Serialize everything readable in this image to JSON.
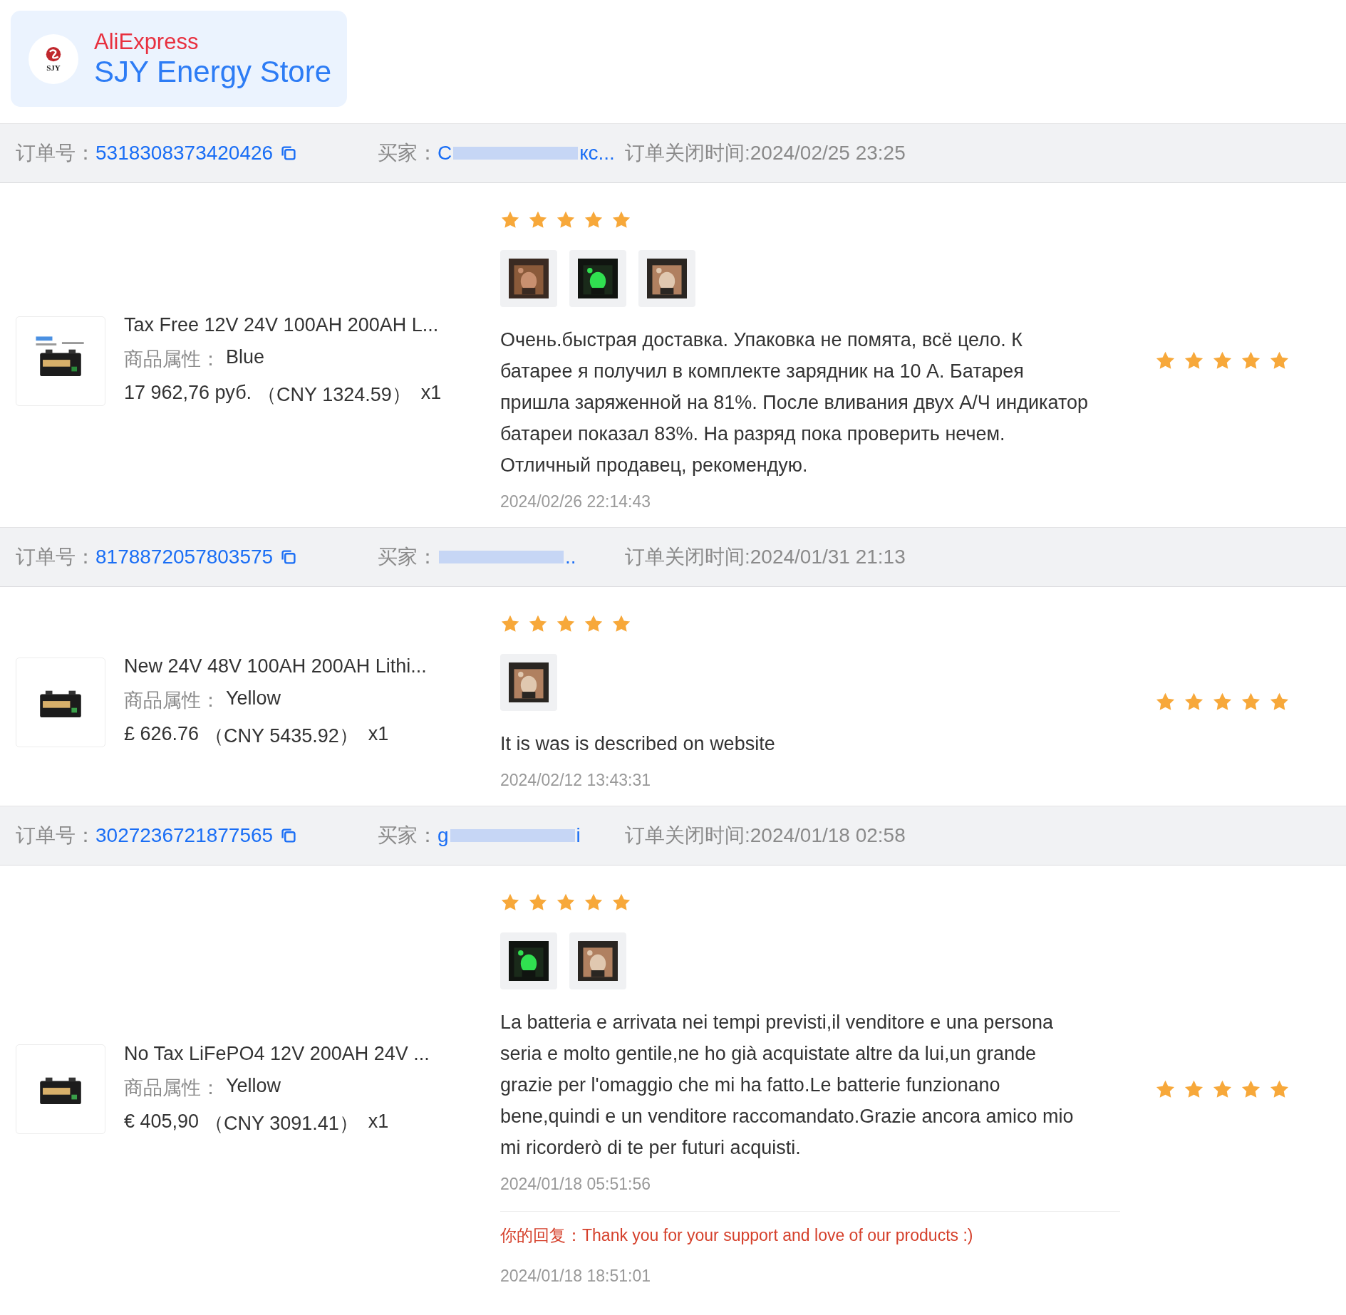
{
  "store": {
    "logo_text": "SJY",
    "platform": "AliExpress",
    "name": "SJY Energy Store"
  },
  "orders": [
    {
      "order_label": "订单号：",
      "order_number": "5318308373420426",
      "buyer_label": "买家：",
      "buyer_start": "C",
      "buyer_end": "кc...",
      "closed_time": "订单关闭时间:2024/02/25 23:25",
      "product": {
        "title": "Tax Free 12V 24V 100AH 200AH L...",
        "attr_label": "商品属性：",
        "attr_value": "Blue",
        "price": "17 962,76 руб.",
        "cny": "（CNY  1324.59）",
        "qty": "x1"
      },
      "review": {
        "stars": 5,
        "photos": [
          {
            "kind": "picture"
          },
          {
            "kind": "picture"
          },
          {
            "kind": "picture"
          }
        ],
        "text": "Очень.быстрая доставка. Упаковка не помята, всё цело. К батарее я получил в комплекте зарядник на 10 А. Батарея пришла заряженной на 81%. После вливания двух А/Ч индикатор батареи показал 83%. На разряд пока проверить нечем. Отличный продавец, рекомендую.",
        "date": "2024/02/26 22:14:43"
      },
      "rating": {
        "stars": 5
      }
    },
    {
      "order_label": "订单号：",
      "order_number": "8178872057803575",
      "buyer_label": "买家：",
      "buyer_end": "..",
      "closed_time": "订单关闭时间:2024/01/31 21:13",
      "product": {
        "title": "New 24V 48V 100AH 200AH Lithi...",
        "attr_label": "商品属性：",
        "attr_value": "Yellow",
        "price": "£ 626.76",
        "cny": "（CNY  5435.92）",
        "qty": "x1"
      },
      "review": {
        "stars": 5,
        "photos": [
          {
            "kind": "picture"
          }
        ],
        "text": "It is was is described on website",
        "date": "2024/02/12 13:43:31"
      },
      "rating": {
        "stars": 5
      }
    },
    {
      "order_label": "订单号：",
      "order_number": "3027236721877565",
      "buyer_label": "买家：",
      "buyer_start": "g",
      "buyer_end": "i",
      "closed_time": "订单关闭时间:2024/01/18 02:58",
      "product": {
        "title": "No Tax LiFePO4 12V 200AH 24V ...",
        "attr_label": "商品属性：",
        "attr_value": "Yellow",
        "price": "€ 405,90",
        "cny": "（CNY  3091.41）",
        "qty": "x1"
      },
      "review": {
        "stars": 5,
        "photos": [
          {
            "kind": "picture"
          },
          {
            "kind": "picture"
          }
        ],
        "text": "La batteria e arrivata nei tempi previsti,il venditore e una persona seria e molto gentile,ne ho già acquistate altre da lui,un grande grazie per l'omaggio che mi ha fatto.Le batterie funzionano bene,quindi e un venditore raccomandato.Grazie ancora amico mio mi ricorderò di te per futuri acquisti.",
        "date": "2024/01/18 05:51:56",
        "reply_label": "你的回复：",
        "reply": "Thank you for your support and love of our products :)",
        "reply_date": "2024/01/18 18:51:01"
      },
      "rating": {
        "stars": 5
      }
    }
  ]
}
